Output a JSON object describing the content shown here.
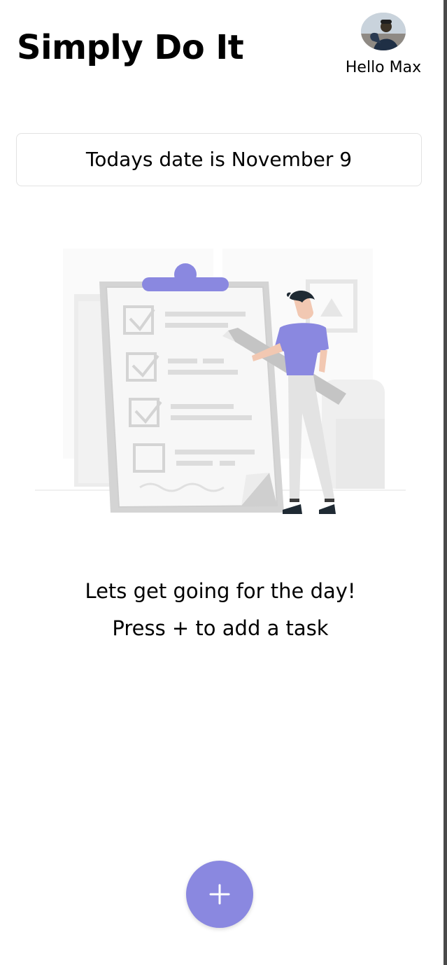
{
  "header": {
    "title": "Simply Do It",
    "greeting": "Hello Max",
    "avatar_icon": "user-photo-icon"
  },
  "date_card": {
    "text": "Todays date is November 9"
  },
  "empty_state": {
    "illustration_icon": "checklist-illustration-icon",
    "line1": "Lets get going for the day!",
    "line2": "Press + to add a task"
  },
  "fab": {
    "icon": "plus-icon",
    "color": "#8a88e0"
  },
  "colors": {
    "accent": "#8a88e0",
    "text": "#000000",
    "background": "#ffffff"
  }
}
